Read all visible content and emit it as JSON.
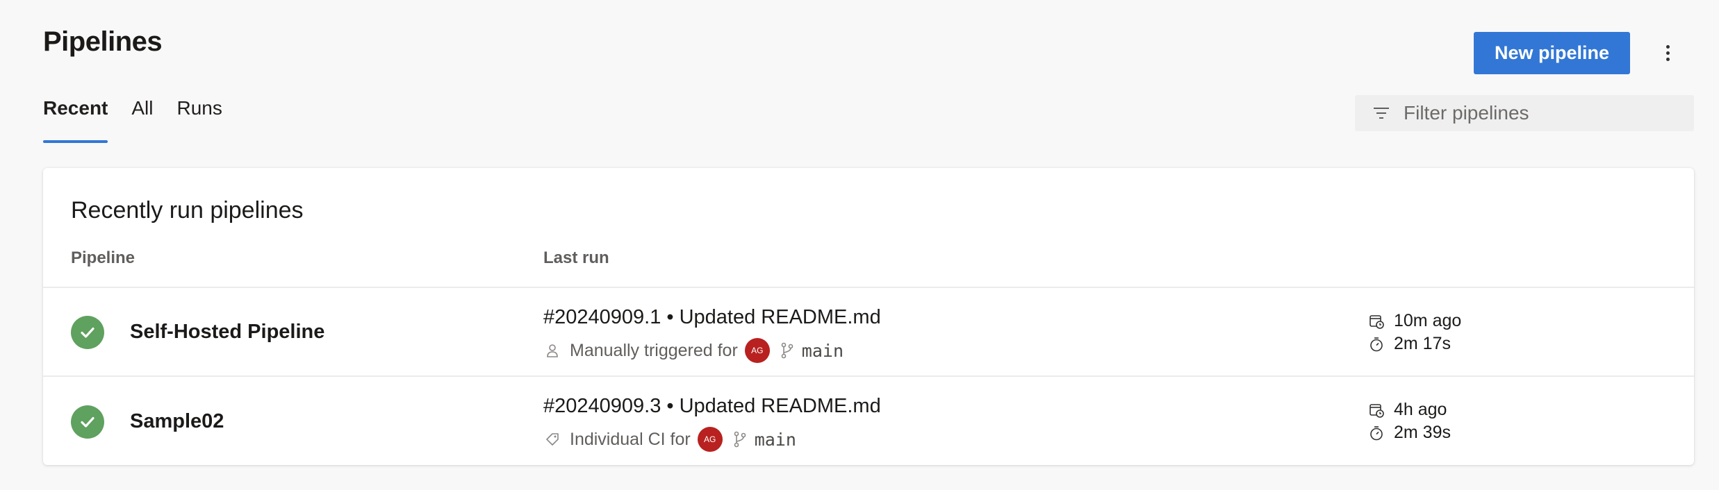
{
  "header": {
    "title": "Pipelines",
    "new_button_label": "New pipeline",
    "more_icon": "more-vertical-icon"
  },
  "tabs": [
    {
      "label": "Recent",
      "active": true
    },
    {
      "label": "All",
      "active": false
    },
    {
      "label": "Runs",
      "active": false
    }
  ],
  "filter": {
    "placeholder": "Filter pipelines",
    "value": "",
    "icon": "filter-icon"
  },
  "card": {
    "title": "Recently run pipelines",
    "columns": {
      "pipeline": "Pipeline",
      "last_run": "Last run"
    }
  },
  "pipelines": [
    {
      "name": "Self-Hosted Pipeline",
      "status": "succeeded",
      "run_title": "#20240909.1 • Updated README.md",
      "trigger_text": "Manually triggered for",
      "trigger_icon": "person-icon",
      "avatar_initials": "AG",
      "branch": "main",
      "started": "10m ago",
      "duration": "2m 17s"
    },
    {
      "name": "Sample02",
      "status": "succeeded",
      "run_title": "#20240909.3 • Updated README.md",
      "trigger_text": "Individual CI for",
      "trigger_icon": "tag-icon",
      "avatar_initials": "AG",
      "branch": "main",
      "started": "4h ago",
      "duration": "2m 39s"
    }
  ],
  "colors": {
    "accent": "#3277d5",
    "success": "#5fa15f",
    "avatar": "#b8211f",
    "background": "#f8f8f8"
  }
}
